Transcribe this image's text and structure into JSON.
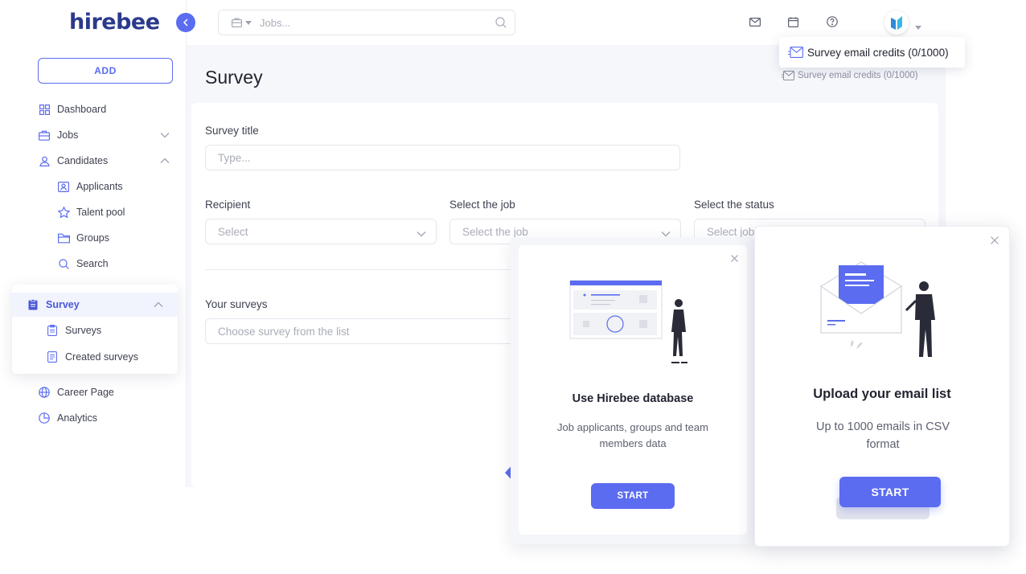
{
  "app": {
    "logo_text": "hirebee"
  },
  "sidebar": {
    "add_label": "ADD",
    "items": [
      {
        "label": "Dashboard",
        "icon": "grid-icon"
      },
      {
        "label": "Jobs",
        "icon": "briefcase-icon"
      },
      {
        "label": "Candidates",
        "icon": "user-icon"
      }
    ],
    "candidates_sub": [
      {
        "label": "Applicants",
        "icon": "id-card-icon"
      },
      {
        "label": "Talent pool",
        "icon": "star-icon"
      },
      {
        "label": "Groups",
        "icon": "folder-icon"
      },
      {
        "label": "Search",
        "icon": "search-icon"
      }
    ],
    "survey": {
      "label": "Survey",
      "sub": [
        {
          "label": "Surveys",
          "icon": "clipboard-icon"
        },
        {
          "label": "Created surveys",
          "icon": "document-icon"
        }
      ]
    },
    "bottom_items": [
      {
        "label": "Career Page",
        "icon": "globe-icon"
      },
      {
        "label": "Analytics",
        "icon": "pie-chart-icon"
      }
    ]
  },
  "topbar": {
    "search_placeholder": "Jobs...",
    "credits_popup": "Survey email credits (0/1000)"
  },
  "main": {
    "title": "Survey",
    "credits_text": "Survey email credits (0/1000)",
    "form": {
      "survey_title_label": "Survey title",
      "survey_title_placeholder": "Type...",
      "recipient_label": "Recipient",
      "recipient_value": "Select",
      "job_label": "Select the job",
      "job_value": "Select the job",
      "status_label": "Select the status",
      "status_value": "Select job",
      "your_surveys_label": "Your surveys",
      "your_surveys_value": "Choose survey from the list"
    }
  },
  "popup_database": {
    "title": "Use Hirebee database",
    "description": "Job applicants, groups and team members data",
    "button": "START"
  },
  "popup_upload": {
    "title": "Upload your email list",
    "description": "Up to 1000 emails in CSV format",
    "button": "START"
  },
  "colors": {
    "accent": "#5b6cf0",
    "brand": "#2b3a8c",
    "background": "#f6f7fb"
  }
}
